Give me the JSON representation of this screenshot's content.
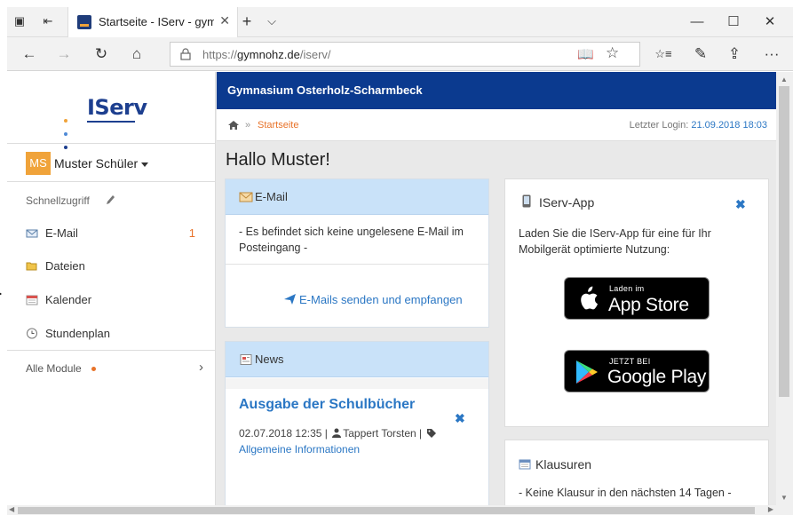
{
  "browser": {
    "tab_title": "Startseite - IServ - gymr",
    "tab_close": "✕",
    "new_tab": "+",
    "tab_list": "⌵",
    "url_prefix": "https://",
    "url_domain": "gymnohz.de",
    "url_path": "/iserv/",
    "window": {
      "minimize": "—",
      "maximize": "☐",
      "close": "✕"
    },
    "nav": {
      "back": "←",
      "forward": "→",
      "refresh": "↻",
      "home": "⌂"
    },
    "actions": {
      "reading_view": "📖",
      "favorite": "☆",
      "favorites_hub": "☆≡",
      "notes": "✎",
      "share": "⇪",
      "more": "···"
    }
  },
  "sidebar": {
    "logo_text": "IServ",
    "logo_dot_colors": [
      "#f0a33a",
      "#4f8ad6",
      "#1d3f8f"
    ],
    "user": {
      "initials": "MS",
      "name": "Muster Schüler"
    },
    "quick_access_label": "Schnellzugriff",
    "items": [
      {
        "label": "E-Mail",
        "count": "1",
        "icon": "mail-icon"
      },
      {
        "label": "Dateien",
        "count": "",
        "icon": "folder-icon"
      },
      {
        "label": "Kalender",
        "count": "",
        "icon": "calendar-icon"
      },
      {
        "label": "Stundenplan",
        "count": "",
        "icon": "clock-icon"
      }
    ],
    "all_modules_label": "Alle Module",
    "all_modules_chevron": "›"
  },
  "header": {
    "school_name": "Gymnasium Osterholz-Scharmbeck",
    "breadcrumb_sep": "»",
    "breadcrumb_current": "Startseite",
    "last_login_label": "Letzter Login:",
    "last_login_value": "21.09.2018 18:03"
  },
  "main": {
    "greeting": "Hallo Muster!",
    "email_panel": {
      "title": "E-Mail",
      "body": "- Es befindet sich keine ungelesene E-Mail im Posteingang -",
      "link": "E-Mails senden und empfangen"
    },
    "news_panel": {
      "title": "News",
      "item_title": "Ausgabe der Schulbücher",
      "close": "✖",
      "date": "02.07.2018 12:35 |",
      "author": "Tappert Torsten |",
      "category": "Allgemeine Informationen"
    },
    "app_panel": {
      "title": "IServ-App",
      "close": "✖",
      "text": "Laden Sie die IServ-App für eine für Ihr Mobilgerät optimierte Nutzung:",
      "app_store_small": "Laden im",
      "app_store_big": "App Store",
      "google_play_small": "JETZT BEI",
      "google_play_big": "Google Play"
    },
    "exam_panel": {
      "title": "Klausuren",
      "text": "- Keine Klausur in den nächsten 14 Tagen -"
    }
  },
  "colors": {
    "school_bar": "#0b3a8f",
    "accent_orange": "#e8732a",
    "link_blue": "#2b77c4",
    "panel_head": "#c9e2f9"
  }
}
